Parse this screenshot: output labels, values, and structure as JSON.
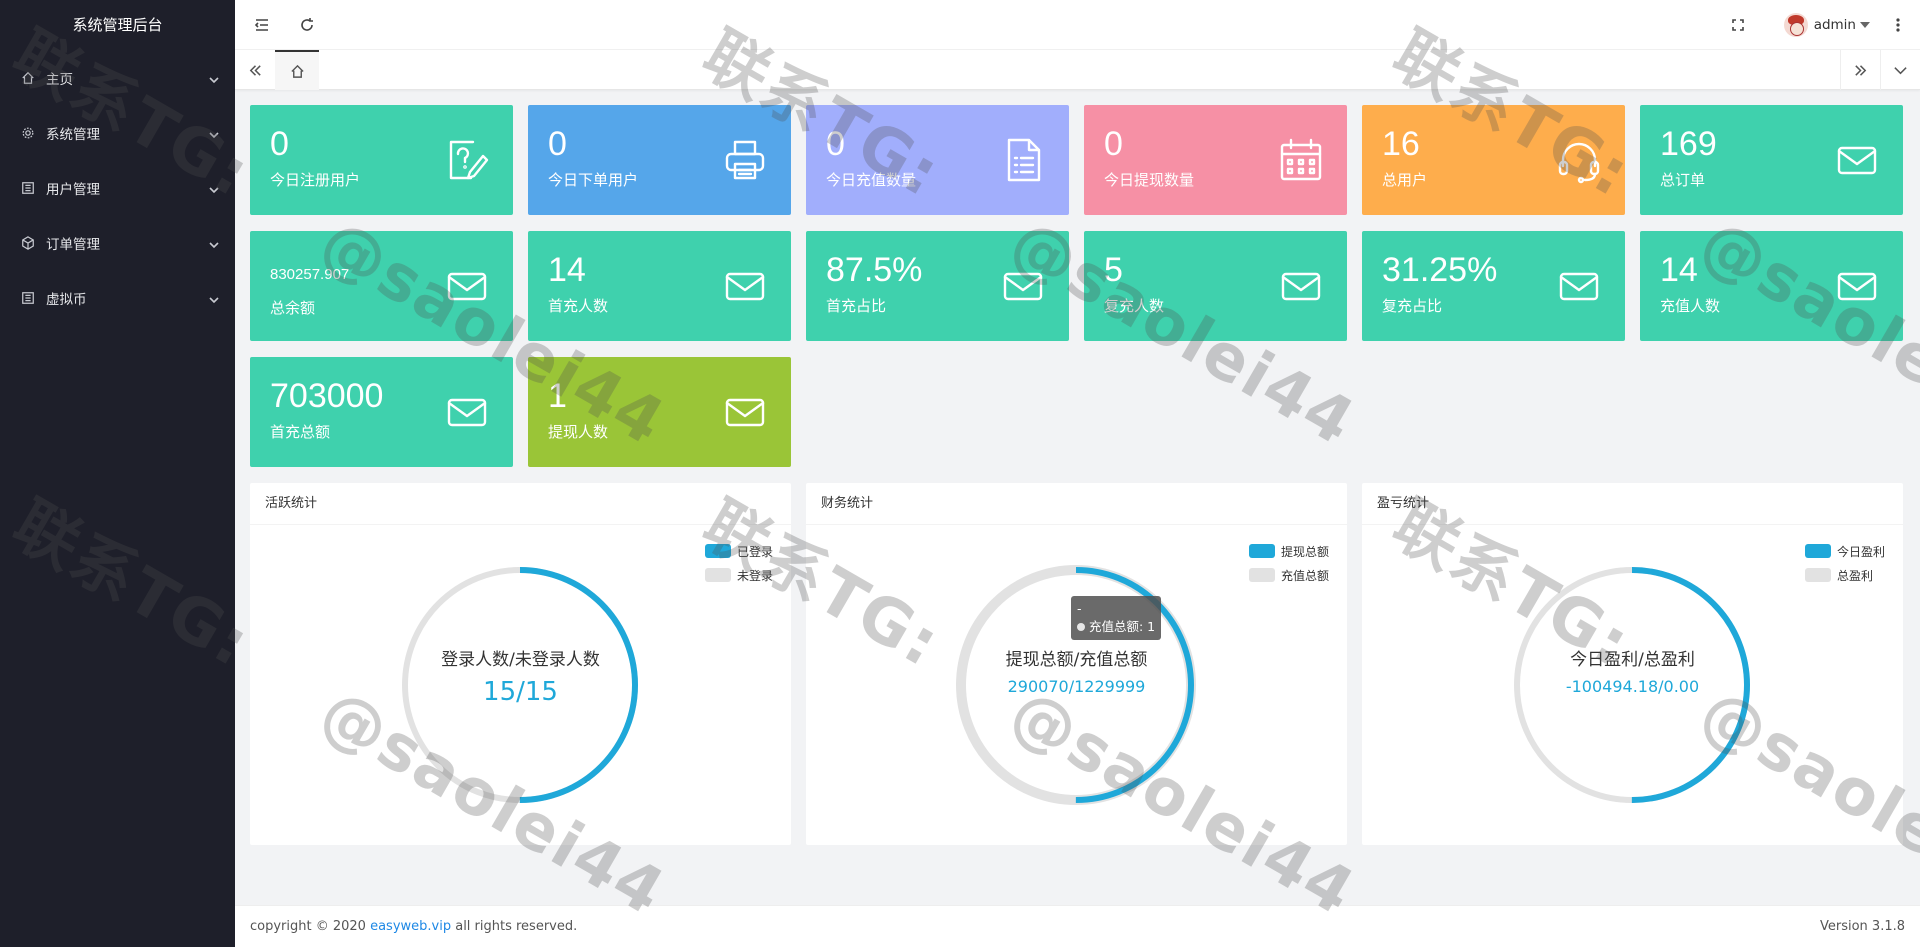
{
  "sidebar": {
    "brand": "系统管理后台",
    "items": [
      {
        "label": "主页",
        "icon": "home-icon"
      },
      {
        "label": "系统管理",
        "icon": "gear-icon"
      },
      {
        "label": "用户管理",
        "icon": "list-icon"
      },
      {
        "label": "订单管理",
        "icon": "cube-icon"
      },
      {
        "label": "虚拟币",
        "icon": "list-icon"
      }
    ]
  },
  "header": {
    "username": "admin"
  },
  "cards": [
    {
      "value": "0",
      "label": "今日注册用户",
      "color": "#3fd1ad",
      "icon": "question-edit-icon"
    },
    {
      "value": "0",
      "label": "今日下单用户",
      "color": "#55a6ea",
      "icon": "printer-icon"
    },
    {
      "value": "0",
      "label": "今日充值数量",
      "color": "#a1aefc",
      "icon": "document-icon"
    },
    {
      "value": "0",
      "label": "今日提现数量",
      "color": "#f690a5",
      "icon": "calendar-icon"
    },
    {
      "value": "16",
      "label": "总用户",
      "color": "#fead4c",
      "icon": "headset-icon"
    },
    {
      "value": "169",
      "label": "总订单",
      "color": "#3fd1ad",
      "icon": "mail-icon"
    },
    {
      "value": "830257.907",
      "label": "总余额",
      "color": "#3fd1ad",
      "icon": "mail-icon"
    },
    {
      "value": "14",
      "label": "首充人数",
      "color": "#3fd1ad",
      "icon": "mail-icon"
    },
    {
      "value": "87.5%",
      "label": "首充占比",
      "color": "#3fd1ad",
      "icon": "mail-icon"
    },
    {
      "value": "5",
      "label": "复充人数",
      "color": "#3fd1ad",
      "icon": "mail-icon"
    },
    {
      "value": "31.25%",
      "label": "复充占比",
      "color": "#3fd1ad",
      "icon": "mail-icon"
    },
    {
      "value": "14",
      "label": "充值人数",
      "color": "#3fd1ad",
      "icon": "mail-icon"
    },
    {
      "value": "703000",
      "label": "首充总额",
      "color": "#3fd1ad",
      "icon": "mail-icon"
    },
    {
      "value": "1",
      "label": "提现人数",
      "color": "#9ac537",
      "icon": "mail-icon"
    }
  ],
  "panels": [
    {
      "title": "活跃统计",
      "legend": [
        {
          "label": "已登录",
          "color": "#1fa8d9"
        },
        {
          "label": "未登录",
          "color": "#e2e2e2"
        }
      ],
      "center_title": "登录人数/未登录人数",
      "center_value": "15/15",
      "share": 0.5
    },
    {
      "title": "财务统计",
      "legend": [
        {
          "label": "提现总额",
          "color": "#1fa8d9"
        },
        {
          "label": "充值总额",
          "color": "#e2e2e2"
        }
      ],
      "center_title": "提现总额/充值总额",
      "center_value": "290070/1229999",
      "share": 0.5,
      "tooltip_title": "-",
      "tooltip_text": "充值总额: 1"
    },
    {
      "title": "盈亏统计",
      "legend": [
        {
          "label": "今日盈利",
          "color": "#1fa8d9"
        },
        {
          "label": "总盈利",
          "color": "#e2e2e2"
        }
      ],
      "center_title": "今日盈利/总盈利",
      "center_value": "-100494.18/0.00",
      "share": 0.5
    }
  ],
  "watermark": {
    "line1": "联系TG:",
    "line2": "@saolei44"
  },
  "footer": {
    "prefix": "copyright © 2020 ",
    "link": "easyweb.vip",
    "suffix": " all rights reserved.",
    "version": "Version 3.1.8"
  }
}
